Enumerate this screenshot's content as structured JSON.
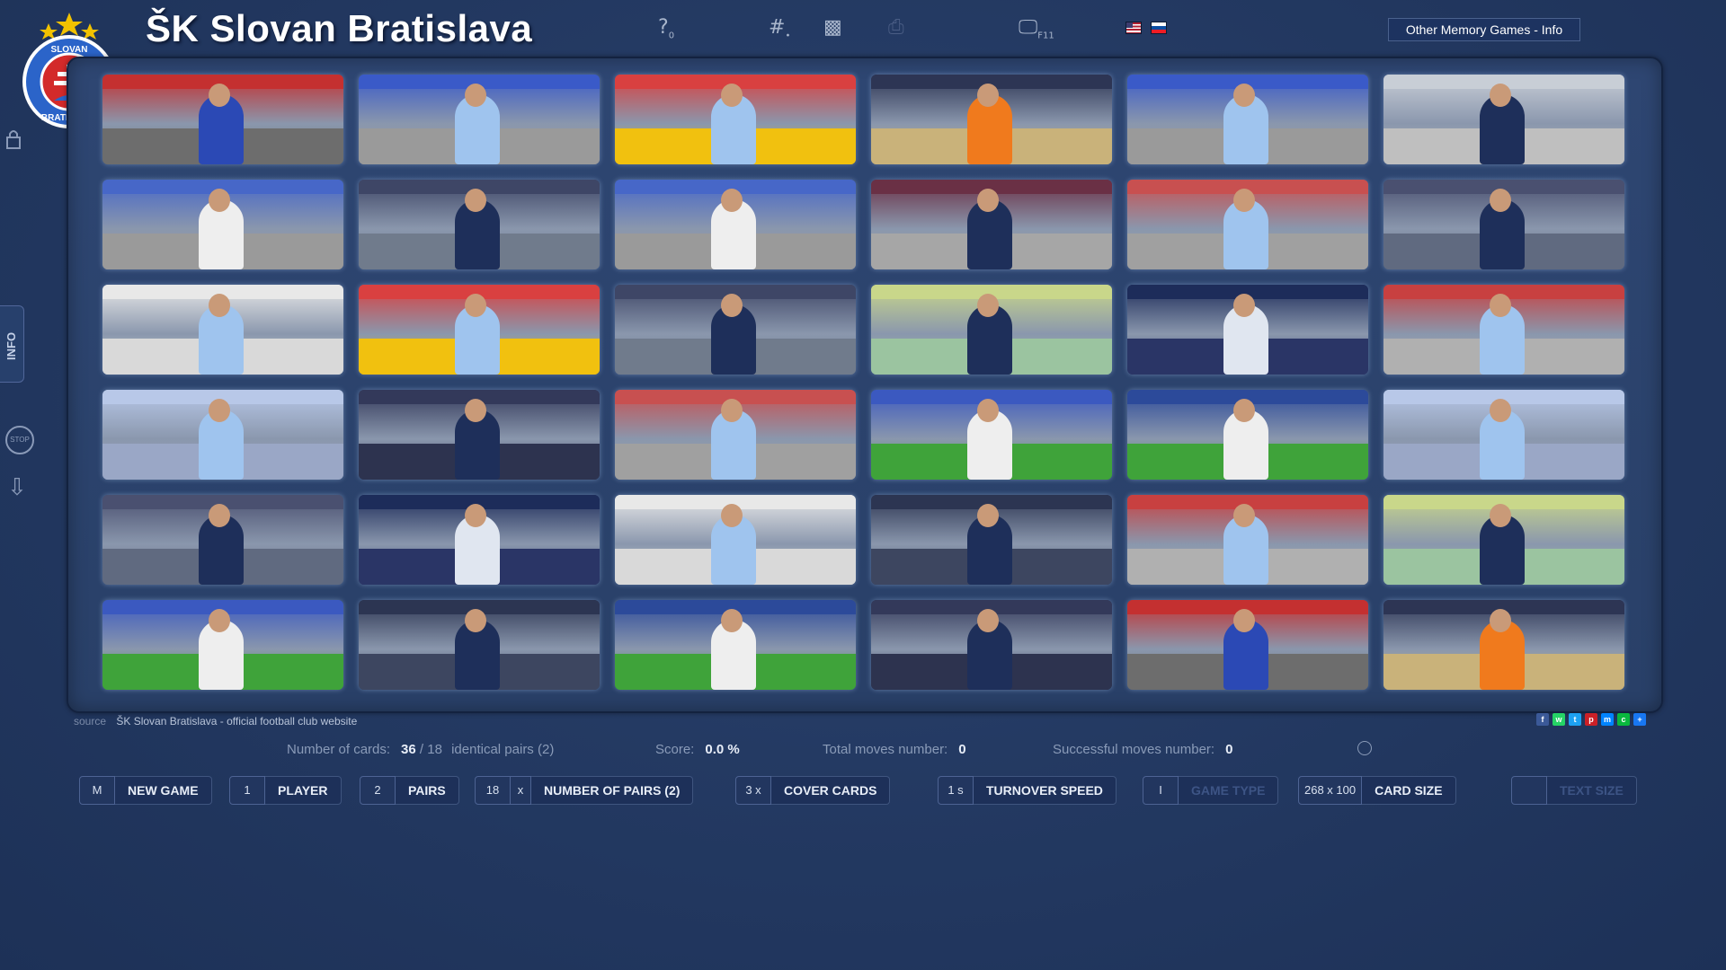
{
  "header": {
    "title": "ŠK Slovan Bratislava",
    "logo_text": "SLOVAN BRATISLAVA",
    "help_icon": "help-icon",
    "toolbar_icons": [
      "help-icon",
      "grid-number-icon",
      "mosaic-icon",
      "print-icon",
      "fullscreen-icon"
    ],
    "fullscreen_key": "F11",
    "help_sub": "0",
    "languages": [
      "en",
      "sk"
    ],
    "info_button": "Other Memory Games - Info"
  },
  "sidebar": {
    "info_label": "INFO",
    "stop_label": "STOP"
  },
  "board": {
    "rows": 6,
    "cols": 6,
    "cards": [
      {
        "theme": "#c43030",
        "kit": "#2b49b5",
        "pitch": "#6d6d6d"
      },
      {
        "theme": "#3a5ac8",
        "kit": "#9fc4ee",
        "pitch": "#9a9a9a"
      },
      {
        "theme": "#d94040",
        "kit": "#9fc4ee",
        "pitch": "#f1c10f"
      },
      {
        "theme": "#2d3554",
        "kit": "#f07a1d",
        "pitch": "#c9b27a"
      },
      {
        "theme": "#3a5ac8",
        "kit": "#9fc4ee",
        "pitch": "#9a9a9a"
      },
      {
        "theme": "#c8ced6",
        "kit": "#1e2f5a",
        "pitch": "#bfbfbf"
      },
      {
        "theme": "#4767c8",
        "kit": "#eeeeee",
        "pitch": "#9a9a9a"
      },
      {
        "theme": "#3e4666",
        "kit": "#1e2f5a",
        "pitch": "#707b8c"
      },
      {
        "theme": "#4767c8",
        "kit": "#eeeeee",
        "pitch": "#9a9a9a"
      },
      {
        "theme": "#6a3045",
        "kit": "#1e2f5a",
        "pitch": "#a6a6a6"
      },
      {
        "theme": "#c85050",
        "kit": "#9fc4ee",
        "pitch": "#a0a0a0"
      },
      {
        "theme": "#4a5070",
        "kit": "#1e2f5a",
        "pitch": "#606a80"
      },
      {
        "theme": "#e8e8e8",
        "kit": "#9fc4ee",
        "pitch": "#d9d9d9"
      },
      {
        "theme": "#d94040",
        "kit": "#9fc4ee",
        "pitch": "#f1c10f"
      },
      {
        "theme": "#3e4666",
        "kit": "#1e2f5a",
        "pitch": "#707b8c"
      },
      {
        "theme": "#c9d78a",
        "kit": "#1e2f5a",
        "pitch": "#9bc4a0"
      },
      {
        "theme": "#1d2c5a",
        "kit": "#e0e6f0",
        "pitch": "#2a3566"
      },
      {
        "theme": "#c84040",
        "kit": "#9fc4ee",
        "pitch": "#b0b0b0"
      },
      {
        "theme": "#b8c8e8",
        "kit": "#9fc4ee",
        "pitch": "#9aa7c6"
      },
      {
        "theme": "#33395a",
        "kit": "#1e2f5a",
        "pitch": "#2d334f"
      },
      {
        "theme": "#c85050",
        "kit": "#9fc4ee",
        "pitch": "#a0a0a0"
      },
      {
        "theme": "#3b59c0",
        "kit": "#eeeeee",
        "pitch": "#3fa33a"
      },
      {
        "theme": "#2c4a9a",
        "kit": "#eeeeee",
        "pitch": "#3fa33a"
      },
      {
        "theme": "#b8c8e8",
        "kit": "#9fc4ee",
        "pitch": "#9aa7c6"
      },
      {
        "theme": "#4a5070",
        "kit": "#1e2f5a",
        "pitch": "#606a80"
      },
      {
        "theme": "#1d2c5a",
        "kit": "#e0e6f0",
        "pitch": "#2a3566"
      },
      {
        "theme": "#e8e8e8",
        "kit": "#9fc4ee",
        "pitch": "#d9d9d9"
      },
      {
        "theme": "#2c3552",
        "kit": "#1e2f5a",
        "pitch": "#3d4660"
      },
      {
        "theme": "#c84040",
        "kit": "#9fc4ee",
        "pitch": "#b0b0b0"
      },
      {
        "theme": "#c9d78a",
        "kit": "#1e2f5a",
        "pitch": "#9bc4a0"
      },
      {
        "theme": "#3b59c0",
        "kit": "#eeeeee",
        "pitch": "#3fa33a"
      },
      {
        "theme": "#2c3552",
        "kit": "#1e2f5a",
        "pitch": "#3d4660"
      },
      {
        "theme": "#2c4a9a",
        "kit": "#eeeeee",
        "pitch": "#3fa33a"
      },
      {
        "theme": "#33395a",
        "kit": "#1e2f5a",
        "pitch": "#2d334f"
      },
      {
        "theme": "#c43030",
        "kit": "#2b49b5",
        "pitch": "#6d6d6d"
      },
      {
        "theme": "#2d3554",
        "kit": "#f07a1d",
        "pitch": "#c9b27a"
      }
    ]
  },
  "source": {
    "label": "source",
    "text": "ŠK Slovan Bratislava - official football club website"
  },
  "share_icons": [
    {
      "name": "facebook-icon",
      "letter": "f",
      "color": "#3b5998"
    },
    {
      "name": "whatsapp-icon",
      "letter": "w",
      "color": "#25d366"
    },
    {
      "name": "twitter-icon",
      "letter": "t",
      "color": "#1da1f2"
    },
    {
      "name": "pinterest-icon",
      "letter": "p",
      "color": "#cb2027"
    },
    {
      "name": "messenger-icon",
      "letter": "m",
      "color": "#0084ff"
    },
    {
      "name": "wechat-icon",
      "letter": "c",
      "color": "#09b83e"
    },
    {
      "name": "addthis-icon",
      "letter": "+",
      "color": "#1877f2"
    }
  ],
  "stats": {
    "cards_label": "Number of cards:",
    "cards_value": "36",
    "cards_slash": " / 18",
    "cards_pairs": "identical pairs (2)",
    "score_label": "Score:",
    "score_value": "0.0 %",
    "total_moves_label": "Total moves number:",
    "total_moves_value": "0",
    "success_moves_label": "Successful moves number:",
    "success_moves_value": "0"
  },
  "controls": [
    {
      "name": "new-game-button",
      "value": "M",
      "label": "NEW GAME",
      "dim": false
    },
    {
      "name": "player-button",
      "value": "1",
      "label": "PLAYER",
      "dim": false
    },
    {
      "name": "pairs-button",
      "value": "2",
      "label": "PAIRS",
      "dim": false
    },
    {
      "name": "number-of-pairs-button",
      "value": "18",
      "extra": "x",
      "label": "NUMBER OF PAIRS (2)",
      "dim": false
    },
    {
      "name": "cover-cards-button",
      "value": "3 x",
      "label": "COVER CARDS",
      "dim": false
    },
    {
      "name": "turnover-speed-button",
      "value": "1 s",
      "label": "TURNOVER SPEED",
      "dim": false
    },
    {
      "name": "game-type-button",
      "value": "I",
      "label": "GAME TYPE",
      "dim": true
    },
    {
      "name": "card-size-button",
      "value": "268 x 100",
      "label": "CARD SIZE",
      "dim": false
    },
    {
      "name": "text-size-button",
      "value": "",
      "label": "TEXT SIZE",
      "dim": true
    }
  ]
}
